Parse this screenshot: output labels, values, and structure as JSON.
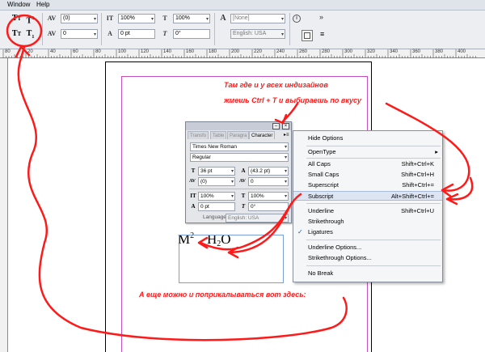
{
  "menubar": {
    "items": [
      "Window",
      "Help"
    ]
  },
  "toolbar": {
    "caps_buttons": [
      "T",
      "T",
      "T",
      "T"
    ],
    "kerning": "(0)",
    "tracking": "0",
    "vscale": "100%",
    "hscale": "100%",
    "baseline": "0 pt",
    "skew": "0°",
    "char_style": "[None]",
    "language": "English: USA"
  },
  "ruler": {
    "marks": [
      "80",
      "20",
      "40",
      "60",
      "80",
      "100",
      "120",
      "140",
      "160",
      "180",
      "200",
      "220",
      "240",
      "260",
      "280",
      "300",
      "320",
      "340",
      "360",
      "380",
      "400"
    ]
  },
  "char_panel": {
    "tabs": [
      "Transfo",
      "Table",
      "Paragra",
      "Character"
    ],
    "font_family": "Times New Roman",
    "font_style": "Regular",
    "size": "36 pt",
    "leading": "(43.2 pt)",
    "kerning": "(0)",
    "tracking": "0",
    "vscale": "100%",
    "hscale": "100%",
    "baseline": "0 pt",
    "skew": "0°",
    "language_label": "Language:",
    "language_value": "English: USA"
  },
  "flyout_menu": {
    "items": [
      {
        "label": "Hide Options",
        "shortcut": ""
      },
      {
        "label": "OpenType",
        "shortcut": ""
      },
      {
        "label": "All Caps",
        "shortcut": "Shift+Ctrl+K"
      },
      {
        "label": "Small Caps",
        "shortcut": "Shift+Ctrl+H"
      },
      {
        "label": "Superscript",
        "shortcut": "Shift+Ctrl+="
      },
      {
        "label": "Subscript",
        "shortcut": "Alt+Shift+Ctrl+="
      },
      {
        "label": "Underline",
        "shortcut": "Shift+Ctrl+U"
      },
      {
        "label": "Strikethrough",
        "shortcut": ""
      },
      {
        "label": "Ligatures",
        "shortcut": ""
      },
      {
        "label": "Underline Options...",
        "shortcut": ""
      },
      {
        "label": "Strikethrough Options...",
        "shortcut": ""
      },
      {
        "label": "No Break",
        "shortcut": ""
      }
    ],
    "submenu_arrow": "▸",
    "check_mark": "✓"
  },
  "sample_text": {
    "m": "M",
    "m_sup": "2",
    "h": "H",
    "h_sub": "2",
    "o": "O"
  },
  "annotations": {
    "line1": "Там где и у всех индизайнов",
    "line2": "жмешь Ctrl + T и выбираешь по вкусу",
    "line3": "А еще можно и поприкалываться вот здесь:"
  },
  "colors": {
    "annotation": "#ff1a1a",
    "margin_guide": "#c34fc3",
    "menu_highlight": "#dde5f3"
  }
}
